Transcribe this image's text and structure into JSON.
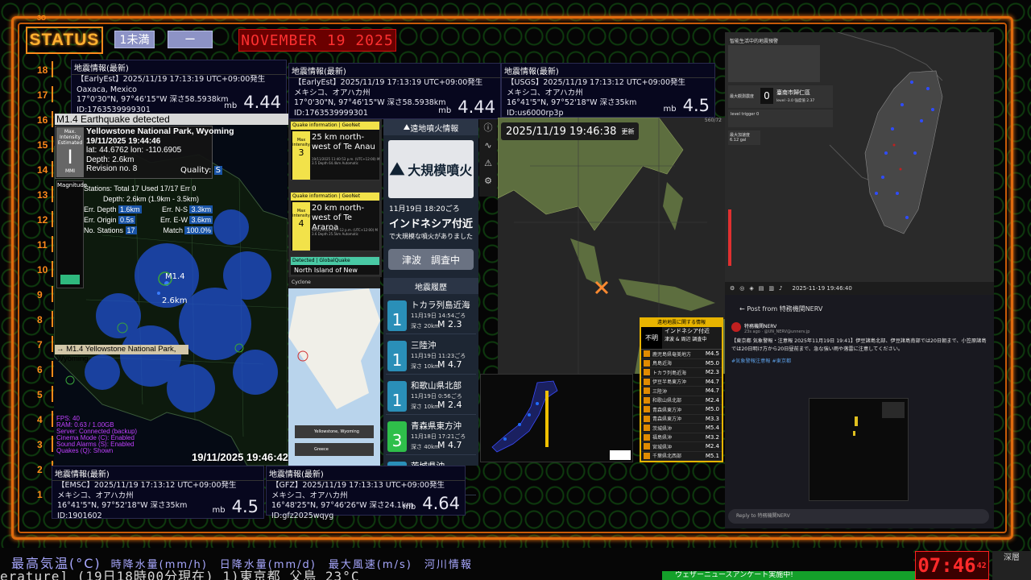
{
  "header": {
    "status_label": "STATUS",
    "chip1": "1未満",
    "chip2": "ー",
    "date": "NOVEMBER 19 2025",
    "ruler_top": "ЗО"
  },
  "ruler": [
    "18",
    "17",
    "16",
    "15",
    "14",
    "13",
    "12",
    "11",
    "10",
    "9",
    "8",
    "7",
    "6",
    "5",
    "4",
    "3",
    "2",
    "1"
  ],
  "cards": {
    "earlyest_small": {
      "title": "地震情報(最新)",
      "source_line": "【EarlyEst】2025/11/19 17:13:19 UTC+09:00発生",
      "place": "Oaxaca, Mexico",
      "coords": "17°0'30\"N, 97°46'15\"W  深さ58.5938km",
      "id": "ID:1763539999301",
      "unit": "mb",
      "mag": "4.44"
    },
    "earlyest_large": {
      "title": "地震情報(最新)",
      "source_line": "【EarlyEst】2025/11/19 17:13:19 UTC+09:00発生",
      "place": "メキシコ、オアハカ州",
      "coords": "17°0'30\"N, 97°46'15\"W  深さ58.5938km",
      "id": "ID:1763539999301",
      "unit": "mb",
      "mag": "4.44"
    },
    "usgs": {
      "title": "地震情報(最新)",
      "source_line": "【USGS】2025/11/19 17:13:12 UTC+09:00発生",
      "place": "メキシコ、オアハカ州",
      "coords": "16°41'5\"N, 97°52'18\"W  深さ35km",
      "id": "ID:us6000rp3p",
      "unit": "mb",
      "mag": "4.5"
    },
    "emsc": {
      "title": "地震情報(最新)",
      "source_line": "【EMSC】2025/11/19 17:13:12 UTC+09:00発生",
      "place": "メキシコ、オアハカ州",
      "coords": "16°41'5\"N, 97°52'18\"W  深さ35km",
      "id": "ID:1901602",
      "unit": "mb",
      "mag": "4.5"
    },
    "gfz": {
      "title": "地震情報(最新)",
      "source_line": "【GFZ】2025/11/19 17:13:13 UTC+09:00発生",
      "place": "メキシコ、オアハカ州",
      "coords": "16°48'25\"N, 97°46'26\"W  深さ24.1km",
      "id": "ID:gfz2025wqyg",
      "unit": "mb",
      "mag": "4.64"
    }
  },
  "detection": {
    "title": "M1.4 Earthquake detected",
    "mmi_label": "Max. Intensity Estimated",
    "mmi_value": "I",
    "mmi_unit": "MMI",
    "place": "Yellowstone National Park, Wyoming",
    "time": "19/11/2025 19:44:46",
    "latlon": "lat: 44.6762 lon: -110.6905",
    "depth": "Depth: 2.6km",
    "revision": "Revision no. 8",
    "quality_label": "Quality:",
    "quality_value": "S",
    "magnitude_label": "Magnitude",
    "stations": "Stations: Total 17 Used 17/17 Err 0",
    "depth_range": "Depth: 2.6km (1.9km - 3.5km)",
    "err_depth_label": "Err. Depth",
    "err_depth": "1.6km",
    "err_ns_label": "Err. N-S",
    "err_ns": "3.3km",
    "err_origin_label": "Err. Origin",
    "err_origin": "0.5s",
    "err_ew_label": "Err. E-W",
    "err_ew": "3.6km",
    "no_stations_label": "No. Stations",
    "no_stations": "17",
    "match_label": "Match",
    "match": "100.0%",
    "map_mag": "M1.4",
    "map_depth": "2.6km",
    "map_label": "→ M1.4 Yellowstone National Park, Wyoming",
    "fps": [
      "FPS: 40",
      "RAM: 0.63 / 1.00GB",
      "Server: Connected (backup)",
      "Cinema Mode (C): Enabled",
      "Sound Alarms (S): Enabled",
      "Quakes (Q): Shown"
    ],
    "timestamp": "19/11/2025 19:46:42"
  },
  "geonet": [
    {
      "header": "Quake information | GeoNet",
      "intensity": "3",
      "intensity_label": "Max intensity",
      "title": "25 km north-west of Te Anau",
      "sub": "19/11/2025 11:40:53 p.m. (UTC+12:00)  M 3.5  Depth 64.4km  Automatic",
      "color": "#f2e24a"
    },
    {
      "header": "Quake information | GeoNet",
      "intensity": "4",
      "intensity_label": "Max intensity",
      "title": "20 km north-west of Te Araroa",
      "sub": "19/11/2025 9:27:12 p.m. (UTC+12:00)  M 3.6  Depth 25.5km  Automatic",
      "color": "#f2e24a"
    },
    {
      "header": "Detected | GlobalQuake",
      "title": "North Island of New",
      "color": "#49c9a4"
    }
  ],
  "cyclone": {
    "label": "Cyclone",
    "item1": "Yellowstone, Wyoming",
    "item2": "Greece"
  },
  "volcano": {
    "header": "遠地噴火情報",
    "card": "大規模噴火",
    "time": "11月19日 18:20ごろ",
    "place": "インドネシア付近",
    "desc": "で大規模な噴火がありました",
    "tsunami": "津波　調査中",
    "history_header": "地震履歴"
  },
  "history": [
    {
      "name": "トカラ列島近海",
      "time": "11月19日 14:54ごろ",
      "depth": "深さ 20km",
      "mag": "M 2.3",
      "int": "1",
      "color": "#2a8fb8"
    },
    {
      "name": "三陸沖",
      "time": "11月19日 11:23ごろ",
      "depth": "深さ 10km",
      "mag": "M 4.7",
      "int": "1",
      "color": "#2a8fb8"
    },
    {
      "name": "和歌山県北部",
      "time": "11月19日 0:56ごろ",
      "depth": "深さ 10km",
      "mag": "M 2.4",
      "int": "1",
      "color": "#2a8fb8"
    },
    {
      "name": "青森県東方沖",
      "time": "11月18日 17:21ごろ",
      "depth": "深さ 40km",
      "mag": "M 4.7",
      "int": "3",
      "color": "#2fbf4a"
    },
    {
      "name": "茨城県沖",
      "time": "",
      "depth": "",
      "mag": "",
      "int": "1",
      "color": "#2a8fb8"
    }
  ],
  "asia": {
    "time": "2025/11/19 19:46:38",
    "suffix": "更新",
    "corner": "560/72"
  },
  "info_panel": {
    "header": "遠地地震に関する情報",
    "status": "不明",
    "region": "インドネシア付近",
    "tsunami": "津波 & 周辺 調査中",
    "rows": [
      {
        "name": "鹿児島県奄美地方",
        "mag": "M4.5"
      },
      {
        "name": "鳥島近海",
        "mag": "M5.0"
      },
      {
        "name": "トカラ列島近海",
        "mag": "M2.3"
      },
      {
        "name": "伊豆半島東方沖",
        "mag": "M4.7"
      },
      {
        "name": "三陸沖",
        "mag": "M4.7"
      },
      {
        "name": "和歌山県北部",
        "mag": "M2.4"
      },
      {
        "name": "青森県東方沖",
        "mag": "M5.0"
      },
      {
        "name": "青森県東方沖",
        "mag": "M3.3"
      },
      {
        "name": "茨城県沖",
        "mag": "M5.4"
      },
      {
        "name": "福島県沖",
        "mag": "M3.2"
      },
      {
        "name": "宮城県沖",
        "mag": "M2.4"
      },
      {
        "name": "千葉県北西部",
        "mag": "M5.1"
      }
    ]
  },
  "taiwan": {
    "title": "智能生活中的地震預警",
    "max_label": "最大觀測震度",
    "max_value": "0",
    "location": "臺南市歸仁區",
    "sub": "level -3.0  強度值 2.37",
    "level": "level",
    "trigger": "trigger",
    "trigger_value": "0",
    "accel_label": "最大加速度",
    "accel": "6.12 gal",
    "time": "2025-11-19 19:46:40"
  },
  "post": {
    "header": "Post from 特務機関NERV",
    "account": "特務機関NERV",
    "handle": "23s ago · @UN_NERV@unnerv.jp",
    "body": "【東京都 気象警報・注意報 2025年11月19日 19:41】伊豆諸島北部、伊豆諸島南部では20日朝まで、小笠原諸島では20日明け方から20日昼前まで、急な強い雨や落雷に注意してください。",
    "tags": "#気象警報注意報 #東京都",
    "reply": "Reply to 特務機関NERV"
  },
  "ticker": {
    "line1_a": "最高気温(°C)",
    "line1_b": "時降水量(mm/h)　日降水量(mm/d)　最大風速(m/s)　河川情報",
    "line2": "erature]  (19日18時00分現在)    1)東京都 父島 23°C",
    "green": "ウェザーニュースアンケート実施中!",
    "clock": "07:46",
    "clock_sec": "42",
    "corner": "深層"
  },
  "colors": {
    "accent": "#e06a0e",
    "grid": "#0e3a0e",
    "alert": "#ff2a2a"
  }
}
